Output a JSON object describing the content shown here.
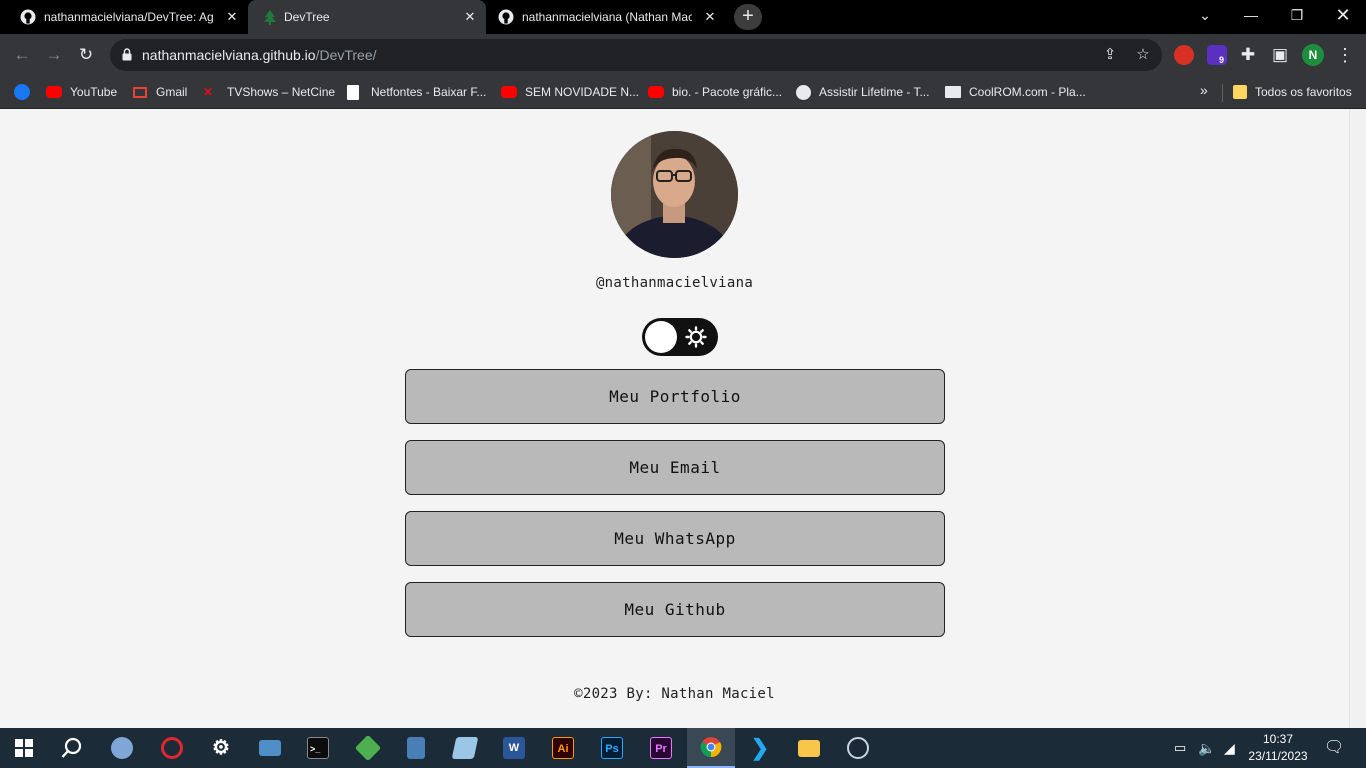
{
  "browser": {
    "tabs": [
      {
        "title": "nathanmacielviana/DevTree: Agr",
        "favicon": "github-icon",
        "active": false
      },
      {
        "title": "DevTree",
        "favicon": "tree-icon",
        "active": true
      },
      {
        "title": "nathanmacielviana (Nathan Mac",
        "favicon": "github-icon",
        "active": false
      }
    ],
    "new_tab_label": "+",
    "url_host": "nathanmacielviana.github.io",
    "url_path": "/DevTree/",
    "profile_initial": "N",
    "extension_badge": "9",
    "bookmarks": [
      {
        "label": "",
        "icon": "facebook-icon",
        "color": "#1877f2"
      },
      {
        "label": "YouTube",
        "icon": "youtube-icon",
        "color": "#ff0000"
      },
      {
        "label": "Gmail",
        "icon": "gmail-icon",
        "color": "#ea4335"
      },
      {
        "label": "TVShows – NetCine",
        "icon": "netcine-icon",
        "color": "#e50914"
      },
      {
        "label": "Netfontes - Baixar F...",
        "icon": "netfontes-icon",
        "color": "#ffffff"
      },
      {
        "label": "SEM NOVIDADE N...",
        "icon": "youtube-icon",
        "color": "#ff0000"
      },
      {
        "label": "bio. - Pacote gráfic...",
        "icon": "youtube-icon",
        "color": "#ff0000"
      },
      {
        "label": "Assistir Lifetime - T...",
        "icon": "globe-icon",
        "color": "#ffffff"
      },
      {
        "label": "CoolROM.com - Pla...",
        "icon": "coolrom-icon",
        "color": "#ffffff"
      }
    ],
    "bookmarks_overflow": "»",
    "all_bookmarks_label": "Todos os favoritos"
  },
  "page": {
    "handle": "@nathanmacielviana",
    "theme_toggle": "light",
    "links": [
      {
        "label": "Meu Portfolio"
      },
      {
        "label": "Meu Email"
      },
      {
        "label": "Meu WhatsApp"
      },
      {
        "label": "Meu Github"
      }
    ],
    "footer": "©2023 By: Nathan Maciel"
  },
  "taskbar": {
    "items": [
      "windows-start-icon",
      "search-icon",
      "paint-icon",
      "opera-icon",
      "settings-icon",
      "file-manager-icon",
      "terminal-icon",
      "cube-app-icon",
      "calculator-icon",
      "notes-icon",
      "word-icon",
      "illustrator-icon",
      "photoshop-icon",
      "premiere-icon",
      "chrome-icon",
      "vscode-icon",
      "explorer-icon",
      "steam-icon"
    ],
    "time": "10:37",
    "date": "23/11/2023"
  }
}
